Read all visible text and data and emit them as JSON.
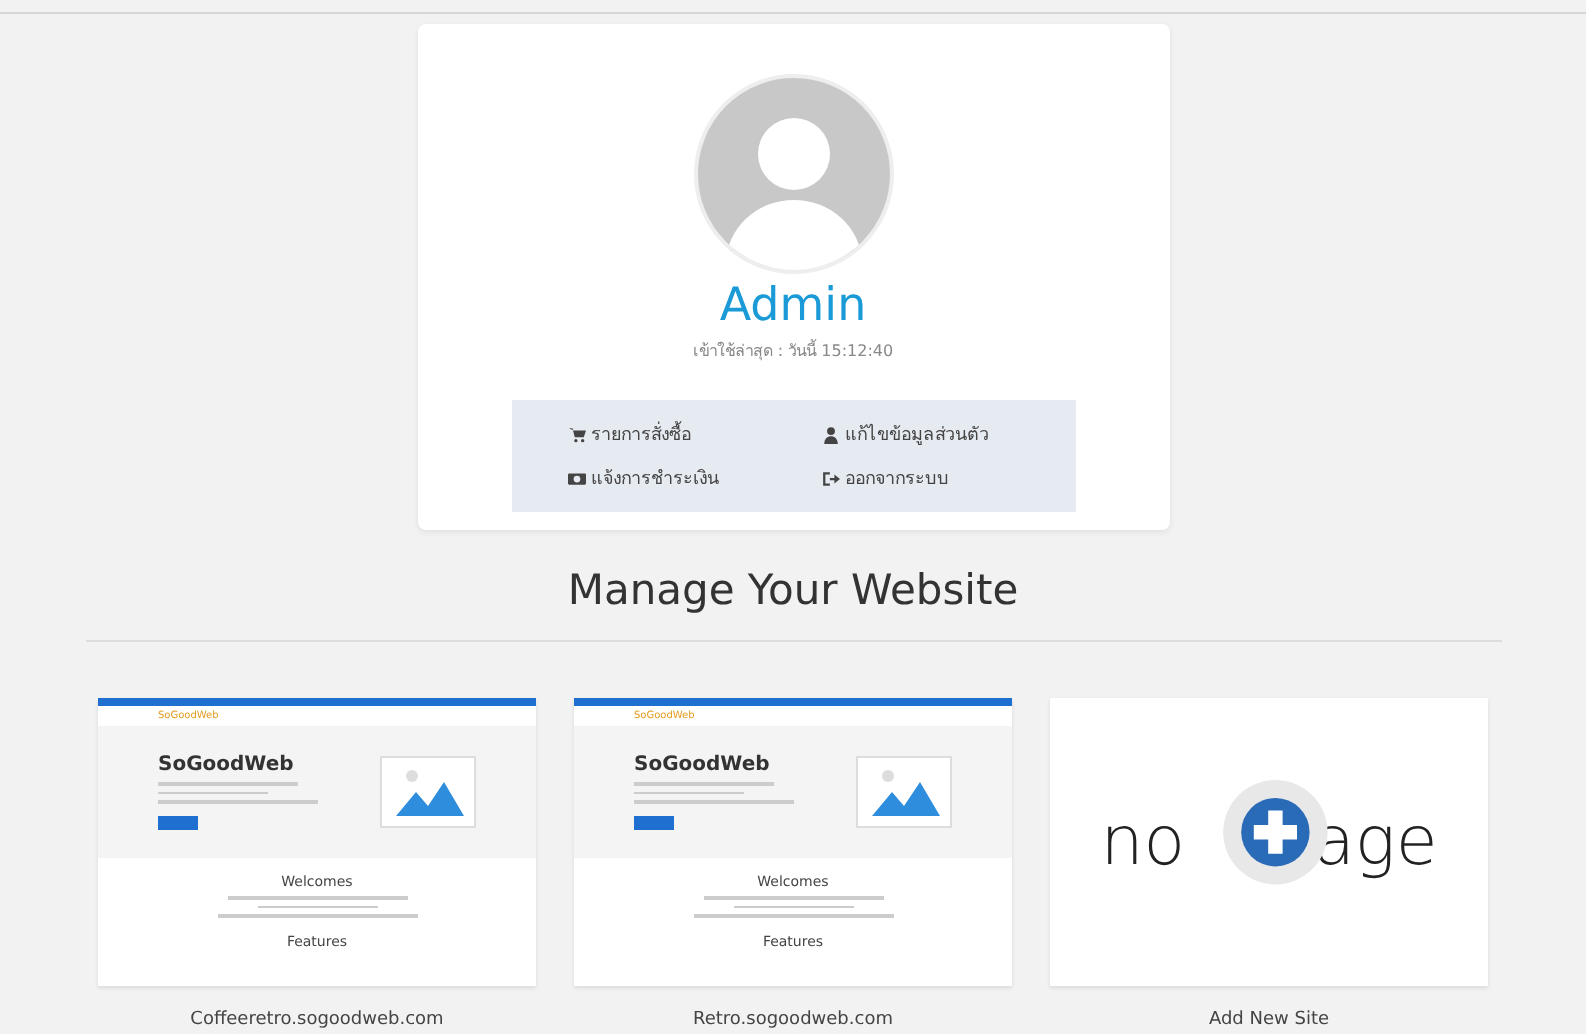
{
  "profile": {
    "name": "Admin",
    "last_login": "เข้าใช้ล่าสุด : วันนี้ 15:12:40",
    "menu": [
      {
        "kind": "cart",
        "label": "รายการสั่งซื้อ"
      },
      {
        "kind": "user",
        "label": "แก้ไขข้อมูลส่วนตัว"
      },
      {
        "kind": "money",
        "label": "แจ้งการชำระเงิน"
      },
      {
        "kind": "logout",
        "label": "ออกจากระบบ"
      }
    ]
  },
  "section_title": "Manage Your Website",
  "sites": [
    {
      "kind": "site",
      "caption": "Coffeeretro.sogoodweb.com",
      "preview": {
        "logo": "SoGoodWeb",
        "headline": "SoGoodWeb",
        "welcome": "Welcomes",
        "features": "Features"
      }
    },
    {
      "kind": "site",
      "caption": "Retro.sogoodweb.com",
      "preview": {
        "logo": "SoGoodWeb",
        "headline": "SoGoodWeb",
        "welcome": "Welcomes",
        "features": "Features"
      }
    },
    {
      "kind": "add",
      "caption": "Add New Site",
      "placeholder_left": "no",
      "placeholder_right": "age"
    }
  ]
}
